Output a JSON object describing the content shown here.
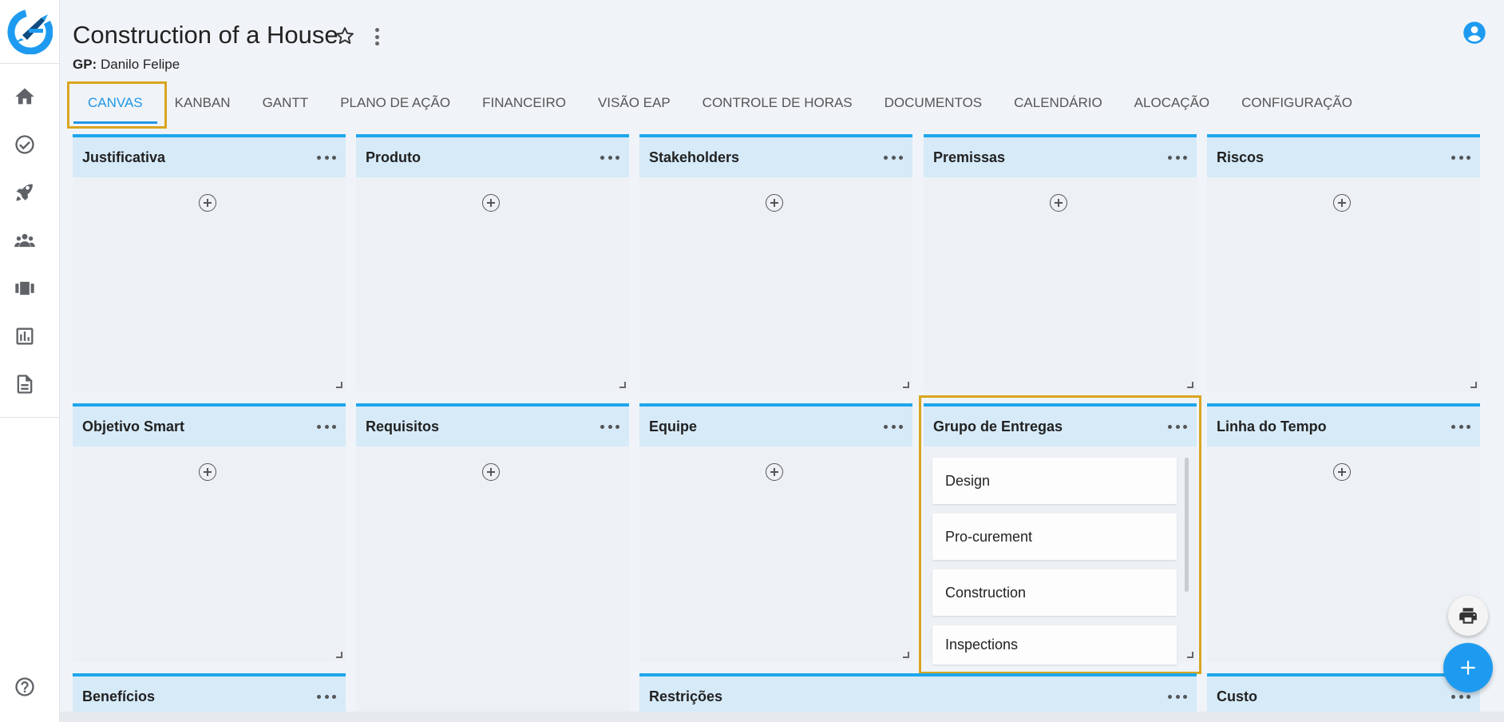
{
  "header": {
    "title": "Construction of a House",
    "gp_label": "GP:",
    "gp_value": "Danilo Felipe"
  },
  "tabs": [
    {
      "label": "CANVAS",
      "active": true
    },
    {
      "label": "KANBAN"
    },
    {
      "label": "GANTT"
    },
    {
      "label": "PLANO DE AÇÃO"
    },
    {
      "label": "FINANCEIRO"
    },
    {
      "label": "VISÃO EAP"
    },
    {
      "label": "CONTROLE DE HORAS"
    },
    {
      "label": "DOCUMENTOS"
    },
    {
      "label": "CALENDÁRIO"
    },
    {
      "label": "ALOCAÇÃO"
    },
    {
      "label": "CONFIGURAÇÃO"
    }
  ],
  "sidebar": {
    "items": [
      {
        "icon": "home-icon"
      },
      {
        "icon": "check-circle-icon"
      },
      {
        "icon": "rocket-icon"
      },
      {
        "icon": "people-icon"
      },
      {
        "icon": "carousel-icon"
      },
      {
        "icon": "bar-chart-icon"
      },
      {
        "icon": "document-icon"
      }
    ],
    "help_icon": "help-icon"
  },
  "cards": [
    {
      "title": "Justificativa"
    },
    {
      "title": "Produto"
    },
    {
      "title": "Stakeholders"
    },
    {
      "title": "Premissas"
    },
    {
      "title": "Riscos"
    },
    {
      "title": "Objetivo Smart"
    },
    {
      "title": "Requisitos"
    },
    {
      "title": "Equipe"
    },
    {
      "title": "Grupo de Entregas",
      "items": [
        "Design",
        "Pro-curement",
        "Construction",
        "Inspections"
      ]
    },
    {
      "title": "Linha do Tempo"
    },
    {
      "title": "Benefícios"
    },
    {
      "title": "Restrições"
    },
    {
      "title": "Custo"
    }
  ],
  "colors": {
    "accent": "#2196e6",
    "card_border": "#1ea7ec",
    "card_header": "#d6eaf8",
    "highlight": "#d9a520",
    "fab": "#1e9bf0"
  }
}
